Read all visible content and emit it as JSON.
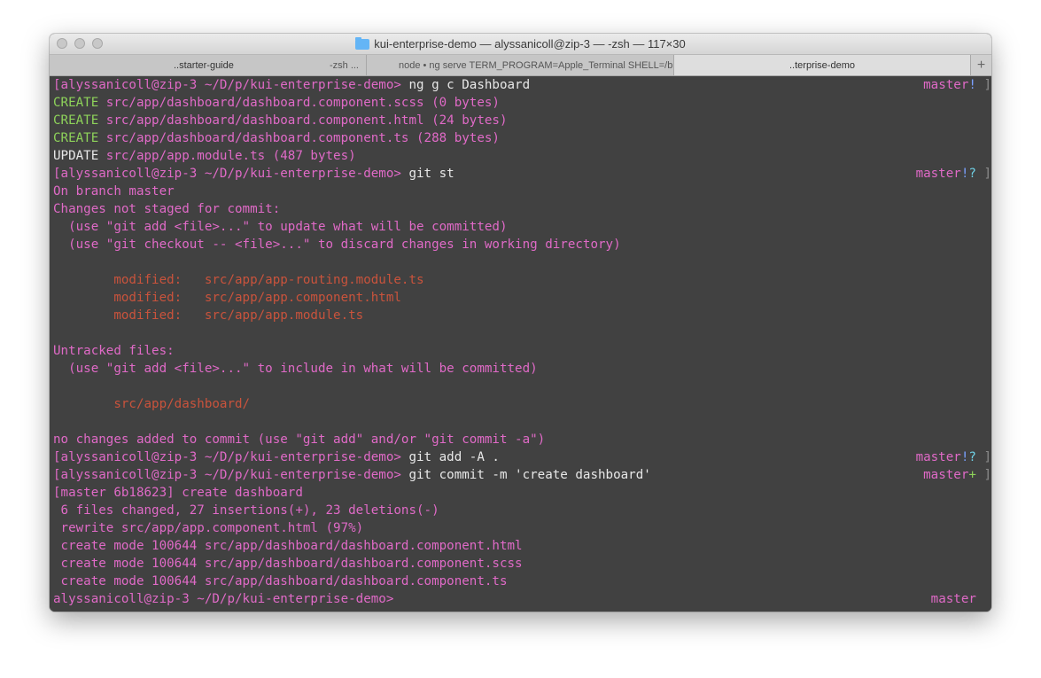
{
  "window": {
    "title": "kui-enterprise-demo — alyssanicoll@zip-3 — -zsh — 117×30"
  },
  "tabs": [
    {
      "label": "..starter-guide",
      "side": "-zsh ...",
      "active": false
    },
    {
      "label": "node • ng serve TERM_PROGRAM=Apple_Terminal SHELL=/bin/z",
      "active": false
    },
    {
      "label": "..terprise-demo",
      "active": true
    }
  ],
  "new_tab_label": "+",
  "colors": {
    "background": "#414141",
    "prompt": "#e06ac7",
    "create": "#8ed35a",
    "modified": "#c9533c",
    "status_question": "#6fd1e6",
    "status_plus": "#8ed35a"
  },
  "lines": [
    {
      "segments": [
        {
          "t": "[alyssanicoll@zip-3 ~/D/p/kui-enterprise-demo> ",
          "c": "c-prompt"
        },
        {
          "t": "ng g c Dashboard",
          "c": "c-white"
        }
      ],
      "right": [
        {
          "t": "master",
          "c": "c-prompt"
        },
        {
          "t": "!",
          "c": "c-bang"
        },
        {
          "t": " ]",
          "c": "c-bracket"
        }
      ]
    },
    {
      "segments": [
        {
          "t": "CREATE ",
          "c": "c-green"
        },
        {
          "t": "src/app/dashboard/dashboard.component.scss (0 bytes)",
          "c": "c-mag"
        }
      ]
    },
    {
      "segments": [
        {
          "t": "CREATE ",
          "c": "c-green"
        },
        {
          "t": "src/app/dashboard/dashboard.component.html (24 bytes)",
          "c": "c-mag"
        }
      ]
    },
    {
      "segments": [
        {
          "t": "CREATE ",
          "c": "c-green"
        },
        {
          "t": "src/app/dashboard/dashboard.component.ts (288 bytes)",
          "c": "c-mag"
        }
      ]
    },
    {
      "segments": [
        {
          "t": "UPDATE ",
          "c": "c-white"
        },
        {
          "t": "src/app/app.module.ts (487 bytes)",
          "c": "c-mag"
        }
      ]
    },
    {
      "segments": [
        {
          "t": "[alyssanicoll@zip-3 ~/D/p/kui-enterprise-demo> ",
          "c": "c-prompt"
        },
        {
          "t": "git st",
          "c": "c-white"
        }
      ],
      "right": [
        {
          "t": "master",
          "c": "c-prompt"
        },
        {
          "t": "!",
          "c": "c-bang"
        },
        {
          "t": "?",
          "c": "c-cyan"
        },
        {
          "t": " ]",
          "c": "c-bracket"
        }
      ]
    },
    {
      "segments": [
        {
          "t": "On branch master",
          "c": "c-mag"
        }
      ]
    },
    {
      "segments": [
        {
          "t": "Changes not staged for commit:",
          "c": "c-mag"
        }
      ]
    },
    {
      "segments": [
        {
          "t": "  (use \"git add <file>...\" to update what will be committed)",
          "c": "c-mag"
        }
      ]
    },
    {
      "segments": [
        {
          "t": "  (use \"git checkout -- <file>...\" to discard changes in working directory)",
          "c": "c-mag"
        }
      ]
    },
    {
      "segments": [
        {
          "t": "",
          "c": "c-mag"
        }
      ]
    },
    {
      "segments": [
        {
          "t": "        modified:   src/app/app-routing.module.ts",
          "c": "c-red"
        }
      ]
    },
    {
      "segments": [
        {
          "t": "        modified:   src/app/app.component.html",
          "c": "c-red"
        }
      ]
    },
    {
      "segments": [
        {
          "t": "        modified:   src/app/app.module.ts",
          "c": "c-red"
        }
      ]
    },
    {
      "segments": [
        {
          "t": "",
          "c": "c-mag"
        }
      ]
    },
    {
      "segments": [
        {
          "t": "Untracked files:",
          "c": "c-mag"
        }
      ]
    },
    {
      "segments": [
        {
          "t": "  (use \"git add <file>...\" to include in what will be committed)",
          "c": "c-mag"
        }
      ]
    },
    {
      "segments": [
        {
          "t": "",
          "c": "c-mag"
        }
      ]
    },
    {
      "segments": [
        {
          "t": "        src/app/dashboard/",
          "c": "c-red"
        }
      ]
    },
    {
      "segments": [
        {
          "t": "",
          "c": "c-mag"
        }
      ]
    },
    {
      "segments": [
        {
          "t": "no changes added to commit (use \"git add\" and/or \"git commit -a\")",
          "c": "c-mag"
        }
      ]
    },
    {
      "segments": [
        {
          "t": "[alyssanicoll@zip-3 ~/D/p/kui-enterprise-demo> ",
          "c": "c-prompt"
        },
        {
          "t": "git add -A .",
          "c": "c-white"
        }
      ],
      "right": [
        {
          "t": "master",
          "c": "c-prompt"
        },
        {
          "t": "!",
          "c": "c-bang"
        },
        {
          "t": "?",
          "c": "c-cyan"
        },
        {
          "t": " ]",
          "c": "c-bracket"
        }
      ]
    },
    {
      "segments": [
        {
          "t": "[alyssanicoll@zip-3 ~/D/p/kui-enterprise-demo> ",
          "c": "c-prompt"
        },
        {
          "t": "git commit -m 'create dashboard'",
          "c": "c-white"
        }
      ],
      "right": [
        {
          "t": "master",
          "c": "c-prompt"
        },
        {
          "t": "+",
          "c": "c-green"
        },
        {
          "t": " ]",
          "c": "c-bracket"
        }
      ]
    },
    {
      "segments": [
        {
          "t": "[master 6b18623] create dashboard",
          "c": "c-mag"
        }
      ]
    },
    {
      "segments": [
        {
          "t": " 6 files changed, 27 insertions(+), 23 deletions(-)",
          "c": "c-mag"
        }
      ]
    },
    {
      "segments": [
        {
          "t": " rewrite src/app/app.component.html (97%)",
          "c": "c-mag"
        }
      ]
    },
    {
      "segments": [
        {
          "t": " create mode 100644 src/app/dashboard/dashboard.component.html",
          "c": "c-mag"
        }
      ]
    },
    {
      "segments": [
        {
          "t": " create mode 100644 src/app/dashboard/dashboard.component.scss",
          "c": "c-mag"
        }
      ]
    },
    {
      "segments": [
        {
          "t": " create mode 100644 src/app/dashboard/dashboard.component.ts",
          "c": "c-mag"
        }
      ]
    },
    {
      "segments": [
        {
          "t": "alyssanicoll@zip-3 ~/D/p/kui-enterprise-demo> ",
          "c": "c-prompt"
        }
      ],
      "right": [
        {
          "t": "master  ",
          "c": "c-prompt"
        }
      ]
    }
  ]
}
